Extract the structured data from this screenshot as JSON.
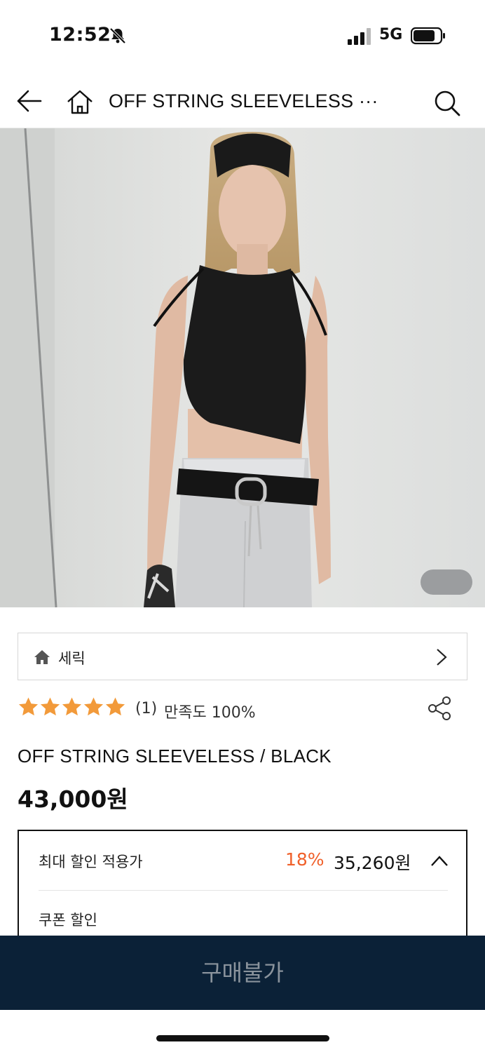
{
  "status_bar": {
    "time": "12:52",
    "network": "5G",
    "icons": [
      "bell-slash-icon",
      "signal-icon",
      "battery-icon"
    ]
  },
  "nav": {
    "title": "OFF STRING SLEEVELESS ···",
    "icons": [
      "back-arrow-icon",
      "home-icon",
      "search-icon"
    ]
  },
  "brand": {
    "name": "세릭"
  },
  "rating": {
    "stars": 5,
    "count": "(1)",
    "satisfaction": "만족도 100%"
  },
  "product": {
    "name": "OFF STRING SLEEVELESS / BLACK",
    "price": "43,000원"
  },
  "discount": {
    "label": "최대 할인 적용가",
    "rate": "18%",
    "price": "35,260원",
    "coupon_label": "쿠폰 할인"
  },
  "buy_button": {
    "label": "구매불가"
  },
  "colors": {
    "accent": "#f0602a",
    "star": "#f29a3a",
    "buy_bar": "#0b2137"
  }
}
